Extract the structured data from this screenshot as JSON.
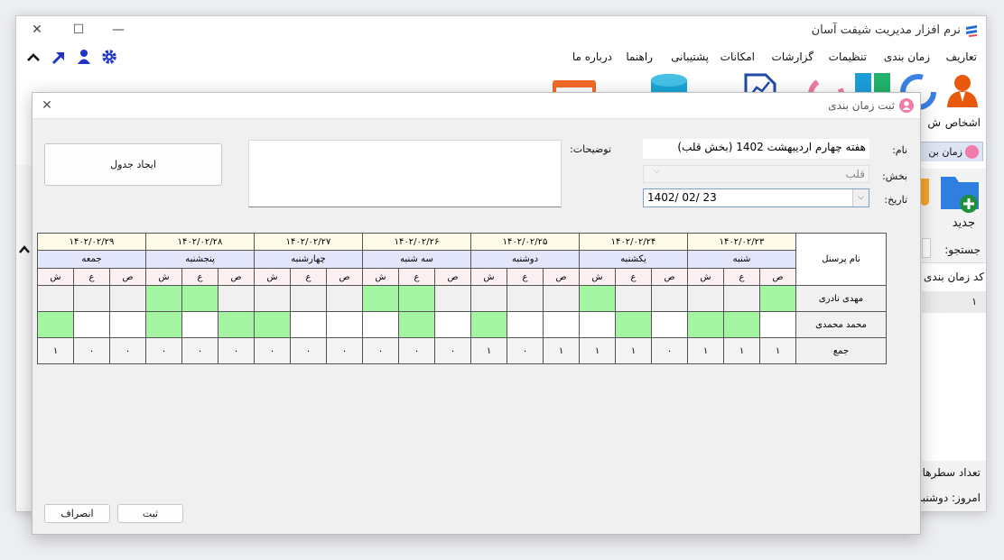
{
  "app": {
    "title": "نرم افزار مدیریت شیفت آسان"
  },
  "menu": [
    "تعاریف",
    "زمان بندی",
    "تنظیمات",
    "گزارشات",
    "امکانات",
    "پشتیبانی",
    "راهنما",
    "درباره ما"
  ],
  "ribbon": {
    "persons_label": "اشخاص",
    "persons_label_cut": "ش"
  },
  "side": {
    "new_label": "جدید",
    "tab_label": "زمان بن",
    "search_label": "جستجو:",
    "col_header": "کد زمان بندی",
    "first_row": "۱",
    "rowcount_label": "تعداد سطرها:",
    "today_label": "امروز: دوشنبه"
  },
  "dialog": {
    "title": "ثبت زمان بندی",
    "name_label": "نام:",
    "name_value": "هفته چهارم اردیبهشت 1402 (بخش قلب)",
    "section_label": "بخش:",
    "section_value": "قلب",
    "date_label": "تاریخ:",
    "date_value": "1402/ 02/ 23",
    "desc_label": "توضیحات:",
    "create_table_label": "ایجاد جدول",
    "save_label": "ثبت",
    "cancel_label": "انصراف"
  },
  "schedule": {
    "personnel_header": "نام پرسنل",
    "total_label": "جمع",
    "shift_labels": [
      "ص",
      "ع",
      "ش"
    ],
    "days": [
      {
        "date": "۱۴۰۲/۰۲/۲۳",
        "name": "شنبه"
      },
      {
        "date": "۱۴۰۲/۰۲/۲۴",
        "name": "یکشنبه"
      },
      {
        "date": "۱۴۰۲/۰۲/۲۵",
        "name": "دوشنبه"
      },
      {
        "date": "۱۴۰۲/۰۲/۲۶",
        "name": "سه شنبه"
      },
      {
        "date": "۱۴۰۲/۰۲/۲۷",
        "name": "چهارشنبه"
      },
      {
        "date": "۱۴۰۲/۰۲/۲۸",
        "name": "پنجشنبه"
      },
      {
        "date": "۱۴۰۲/۰۲/۲۹",
        "name": "جمعه"
      }
    ],
    "rows": [
      {
        "name": "مهدی نادری",
        "cells": [
          "on",
          "na",
          "na",
          "na",
          "na",
          "on",
          "na",
          "na",
          "na",
          "na",
          "on",
          "on",
          "na",
          "na",
          "na",
          "na",
          "on",
          "on",
          "na",
          "na",
          "na"
        ]
      },
      {
        "name": "محمد محمدی",
        "cells": [
          "off",
          "on",
          "on",
          "off",
          "on",
          "off",
          "off",
          "off",
          "on",
          "off",
          "on",
          "off",
          "off",
          "off",
          "on",
          "on",
          "off",
          "on",
          "off",
          "off",
          "on"
        ]
      }
    ],
    "totals": [
      "۱",
      "۱",
      "۱",
      "۰",
      "۱",
      "۱",
      "۱",
      "۰",
      "۱",
      "۰",
      "۰",
      "۰",
      "۰",
      "۰",
      "۰",
      "۰",
      "۰",
      "۰",
      "۰",
      "۰",
      "۱"
    ]
  },
  "colors": {
    "accent": "#1f33c7",
    "on": "#a3f5a2",
    "date_bg": "#fffbe9",
    "day_bg": "#e3e6fa",
    "shift_bg": "#fdf0f2"
  }
}
